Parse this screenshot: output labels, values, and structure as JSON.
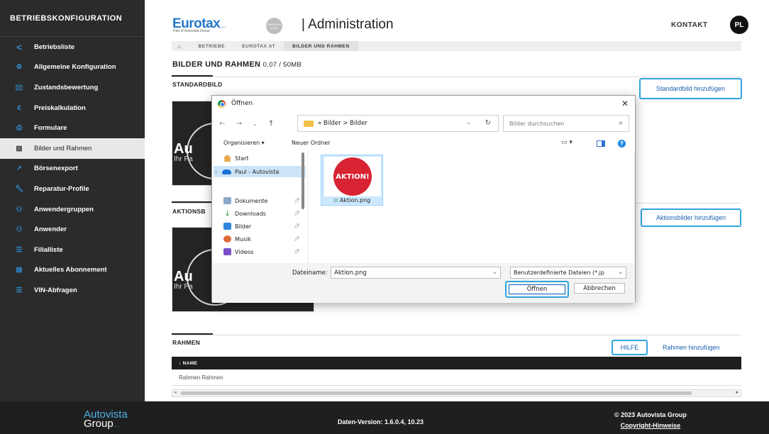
{
  "sidebar": {
    "title": "BETRIEBSKONFIGURATION",
    "items": [
      {
        "label": "Betriebsliste",
        "icon": "chevron-left-icon"
      },
      {
        "label": "Allgemeine Konfiguration",
        "icon": "gear-icon"
      },
      {
        "label": "Zustandsbewertung",
        "icon": "rating-icon"
      },
      {
        "label": "Preiskalkulation",
        "icon": "euro-icon"
      },
      {
        "label": "Formulare",
        "icon": "printer-icon"
      },
      {
        "label": "Bilder und Rahmen",
        "icon": "image-icon"
      },
      {
        "label": "Börsenexport",
        "icon": "export-icon"
      },
      {
        "label": "Reparatur-Profile",
        "icon": "wrench-icon"
      },
      {
        "label": "Anwendergruppen",
        "icon": "users-icon"
      },
      {
        "label": "Anwender",
        "icon": "user-icon"
      },
      {
        "label": "Filialliste",
        "icon": "list-icon"
      },
      {
        "label": "Aktuelles Abonnement",
        "icon": "document-icon"
      },
      {
        "label": "VIN-Abfragen",
        "icon": "list-icon"
      }
    ]
  },
  "header": {
    "brand": "Eurotax",
    "brand_dots": "....",
    "brand_sub": "Part of Autovista Group",
    "partner_logo": "PARTNER LOGO",
    "title": "| Administration",
    "kontakt": "KONTAKT",
    "avatar": "PL"
  },
  "breadcrumb": {
    "items": [
      "BETRIEBE",
      "EUROTAX AT",
      "BILDER UND RAHMEN"
    ]
  },
  "page": {
    "heading": "BILDER UND RAHMEN",
    "size": "0.07 / 50MB"
  },
  "sections": {
    "standard": {
      "title": "STANDARDBILD",
      "add_label": "Standardbild hinzufügen"
    },
    "aktion": {
      "title": "AKTIONSB",
      "add_label": "Aktionsbilder hinzufügen"
    },
    "rahmen": {
      "title": "RAHMEN",
      "help_label": "HILFE",
      "add_label": "Rahmen hinzufügen"
    }
  },
  "card_text": {
    "line1": "Au",
    "line2": "Ihr Pa"
  },
  "table": {
    "column": "NAME",
    "sort_icon": "↕",
    "rows": [
      "Rahmen Rahmen"
    ]
  },
  "dialog": {
    "title": "Öffnen",
    "path": [
      "Bilder",
      "Bilder"
    ],
    "search_placeholder": "Bilder durchsuchen",
    "organize": "Organisieren",
    "new_folder": "Neuer Ordner",
    "nav": [
      {
        "label": "Start",
        "icon": "home-icon"
      },
      {
        "label": "Paul - Autovista",
        "icon": "onedrive-icon"
      },
      {
        "label": "Dokumente",
        "icon": "documents-icon",
        "pinned": true
      },
      {
        "label": "Downloads",
        "icon": "downloads-icon",
        "pinned": true
      },
      {
        "label": "Bilder",
        "icon": "pictures-icon",
        "pinned": true
      },
      {
        "label": "Musik",
        "icon": "music-icon",
        "pinned": true
      },
      {
        "label": "Videos",
        "icon": "videos-icon",
        "pinned": true
      }
    ],
    "file": {
      "name": "Aktion.png",
      "thumb_text": "AKTION!"
    },
    "filename_label": "Dateiname:",
    "filename_value": "Aktion.png",
    "filetype": "Benutzerdefinierte Dateien (*.jp",
    "open_label": "Öffnen",
    "cancel_label": "Abbrechen"
  },
  "footer": {
    "logo_line1": "Autovista",
    "logo_line2": "Group",
    "logo_dots": "....",
    "version": "Daten-Version: 1.6.0.4, 10.23",
    "copyright": "© 2023 Autovista Group",
    "copyright_link": "Copyright-Hinweise"
  },
  "colors": {
    "accent": "#31a5e0",
    "link": "#1a5fb0",
    "brand": "#2478c6",
    "sidebar": "#2b2b2b",
    "aktion_red": "#d82332"
  }
}
